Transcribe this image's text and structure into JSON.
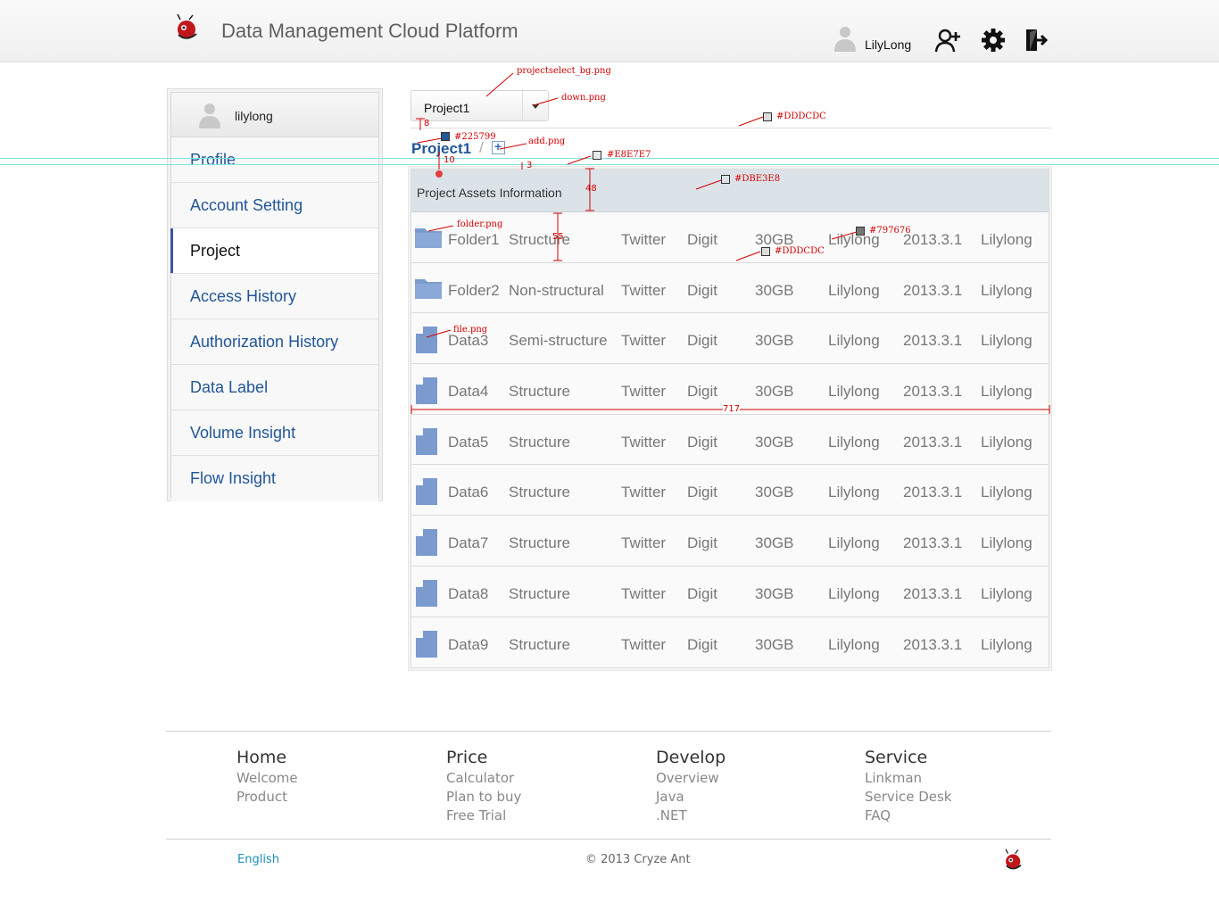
{
  "header": {
    "title": "Data Management Cloud Platform",
    "user": "LilyLong",
    "icons": [
      "logo-icon",
      "user-icon",
      "add-user-icon",
      "gear-icon",
      "logout-icon"
    ]
  },
  "annotations": {
    "projectselect_bg": "projectselect_bg.png",
    "down": "down.png",
    "add": "add.png",
    "folder": "folder.png",
    "file": "file.png",
    "color_rule": "#DDDCDC",
    "color_row_rule": "#DDDCDC",
    "color_link": "#225799",
    "color_border": "#E8E7E7",
    "color_header": "#DBE3E8",
    "color_text": "#797676",
    "num_8": "8",
    "num_10": "10",
    "num_3": "3",
    "num_48": "48",
    "num_55": "55",
    "num_717": "717"
  },
  "sidebar": {
    "username": "lilylong",
    "items": [
      {
        "label": "Profile"
      },
      {
        "label": "Account Setting"
      },
      {
        "label": "Project"
      },
      {
        "label": "Access History"
      },
      {
        "label": "Authorization History"
      },
      {
        "label": "Data Label"
      },
      {
        "label": "Volume Insight"
      },
      {
        "label": "Flow Insight"
      }
    ]
  },
  "project": {
    "selected": "Project1",
    "breadcrumb": "Project1",
    "separator": "/"
  },
  "table": {
    "title": "Project Assets Information",
    "rows": [
      {
        "icon": "folder",
        "name": "Folder1",
        "type": "Structure",
        "source": "Twitter",
        "format": "Digit",
        "size": "30GB",
        "owner": "Lilylong",
        "date": "2013.3.1",
        "by": "Lilylong"
      },
      {
        "icon": "folder",
        "name": "Folder2",
        "type": "Non-structural",
        "source": "Twitter",
        "format": "Digit",
        "size": "30GB",
        "owner": "Lilylong",
        "date": "2013.3.1",
        "by": "Lilylong"
      },
      {
        "icon": "file",
        "name": "Data3",
        "type": "Semi-structure",
        "source": "Twitter",
        "format": "Digit",
        "size": "30GB",
        "owner": "Lilylong",
        "date": "2013.3.1",
        "by": "Lilylong"
      },
      {
        "icon": "file",
        "name": "Data4",
        "type": "Structure",
        "source": "Twitter",
        "format": "Digit",
        "size": "30GB",
        "owner": "Lilylong",
        "date": "2013.3.1",
        "by": "Lilylong"
      },
      {
        "icon": "file",
        "name": "Data5",
        "type": "Structure",
        "source": "Twitter",
        "format": "Digit",
        "size": "30GB",
        "owner": "Lilylong",
        "date": "2013.3.1",
        "by": "Lilylong"
      },
      {
        "icon": "file",
        "name": "Data6",
        "type": "Structure",
        "source": "Twitter",
        "format": "Digit",
        "size": "30GB",
        "owner": "Lilylong",
        "date": "2013.3.1",
        "by": "Lilylong"
      },
      {
        "icon": "file",
        "name": "Data7",
        "type": "Structure",
        "source": "Twitter",
        "format": "Digit",
        "size": "30GB",
        "owner": "Lilylong",
        "date": "2013.3.1",
        "by": "Lilylong"
      },
      {
        "icon": "file",
        "name": "Data8",
        "type": "Structure",
        "source": "Twitter",
        "format": "Digit",
        "size": "30GB",
        "owner": "Lilylong",
        "date": "2013.3.1",
        "by": "Lilylong"
      },
      {
        "icon": "file",
        "name": "Data9",
        "type": "Structure",
        "source": "Twitter",
        "format": "Digit",
        "size": "30GB",
        "owner": "Lilylong",
        "date": "2013.3.1",
        "by": "Lilylong"
      }
    ]
  },
  "footer": {
    "columns": [
      {
        "title": "Home",
        "links": [
          "Welcome",
          "Product"
        ]
      },
      {
        "title": "Price",
        "links": [
          "Calculator",
          "Plan to buy",
          "Free Trial"
        ]
      },
      {
        "title": "Develop",
        "links": [
          "Overview",
          "Java",
          ".NET"
        ]
      },
      {
        "title": "Service",
        "links": [
          "Linkman",
          "Service Desk",
          "FAQ"
        ]
      }
    ],
    "language": "English",
    "copyright": "© 2013 Cryze Ant"
  }
}
